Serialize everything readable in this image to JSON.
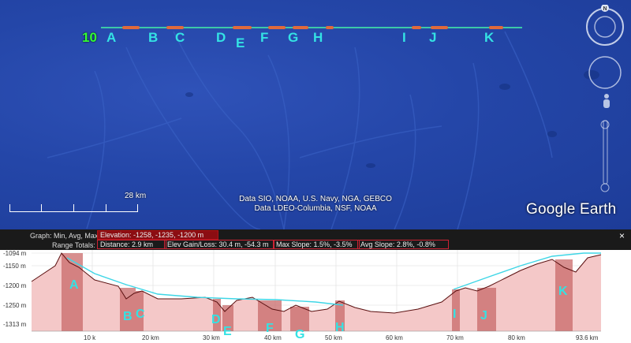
{
  "map": {
    "line_number": "10",
    "markers": [
      "A",
      "B",
      "C",
      "D",
      "E",
      "F",
      "G",
      "H",
      "I",
      "J",
      "K"
    ],
    "scale_label": "28 km",
    "attribution": [
      "Data SIO, NOAA, U.S. Navy, NGA, GEBCO",
      "Data LDEO-Columbia, NSF, NOAA"
    ],
    "logo": "Google Earth",
    "compass_letter": "N"
  },
  "profile": {
    "graph_label": "Graph: Min, Avg, Max",
    "elevation": "Elevation: -1258, -1235, -1200 m",
    "range_label": "Range Totals:",
    "distance": "Distance: 2.9 km",
    "elev_gain_loss": "Elev Gain/Loss: 30.4 m, -54.3 m",
    "max_slope": "Max Slope: 1.5%, -3.5%",
    "avg_slope": "Avg Slope: 2.8%, -0.8%",
    "close": "×",
    "y_ticks": [
      "-1094 m",
      "-1150 m",
      "-1200 m",
      "-1250 m",
      "-1313 m"
    ],
    "x_ticks": [
      "10 k",
      "20 km",
      "30 km",
      "40 km",
      "50 km",
      "60 km",
      "70 km",
      "80 km",
      "93.6 km"
    ]
  },
  "colors": {
    "marker": "#34e2e4",
    "track": "#3cc8a8",
    "segment": "#e06a3c",
    "profile_fill": "#f4c4c4",
    "profile_line": "#5a1010",
    "avg_line": "#3ed6e6"
  }
}
